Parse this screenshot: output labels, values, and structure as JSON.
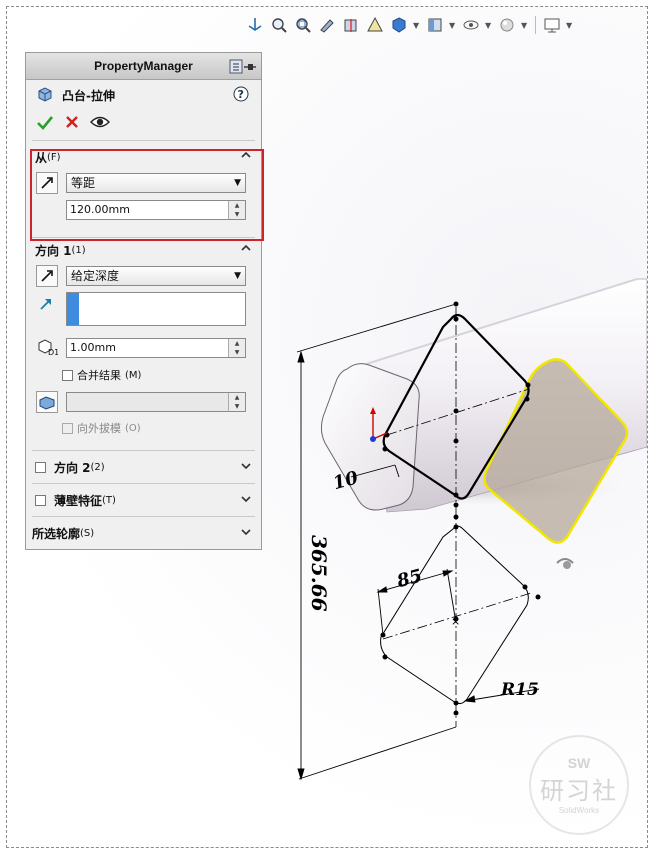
{
  "toolbar": {
    "icons": [
      "view-orientation-icon",
      "zoom-to-fit-icon",
      "zoom-area-icon",
      "previous-view-icon",
      "section-view-icon",
      "dynamic-annotation-icon",
      "view-style-icon",
      "hide-show-icon",
      "edit-appearance-icon",
      "scene-icon",
      "display-settings-icon"
    ]
  },
  "property_manager": {
    "title": "PropertyManager",
    "feature_name": "凸台-拉伸",
    "from": {
      "label": "从",
      "hotkey": "(F)",
      "start_condition": "等距",
      "offset_value": "120.00mm"
    },
    "direction1": {
      "label": "方向 1",
      "hotkey": "(1)",
      "end_condition": "给定深度",
      "depth_value": "1.00mm",
      "merge_result_label": "合并结果",
      "merge_result_hotkey": "(M)",
      "merge_result_checked": false,
      "draft_value": "",
      "draft_outward_label": "向外拔模",
      "draft_outward_hotkey": "(O)"
    },
    "direction2": {
      "label": "方向 2",
      "hotkey": "(2)"
    },
    "thin_feature": {
      "label": "薄壁特征",
      "hotkey": "(T)"
    },
    "selected_contours": {
      "label": "所选轮廓",
      "hotkey": "(S)"
    }
  },
  "viewport": {
    "dimensions": {
      "overall": "365.66",
      "width": "85",
      "radius": "R15",
      "offset": "10"
    }
  },
  "watermark": {
    "sw": "SW",
    "name": "研习社",
    "sub": "SolidWorks"
  },
  "colors": {
    "highlight_box": "#d0222a",
    "preview_outline": "#f2e600",
    "preview_fill": "#b5a89a",
    "accept_green": "#2aa02a",
    "cancel_red": "#d02020"
  }
}
